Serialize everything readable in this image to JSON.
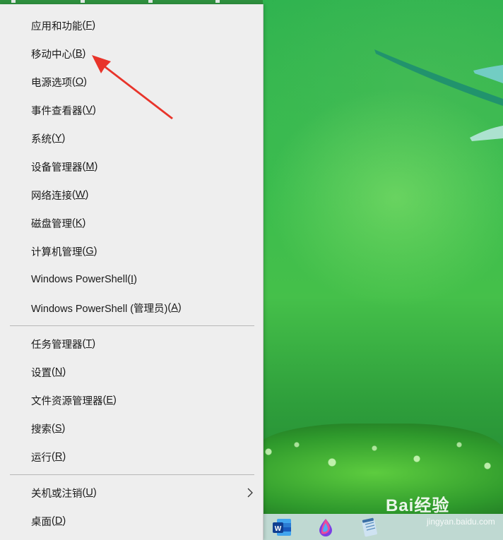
{
  "menu": {
    "group1": [
      {
        "label": "应用和功能",
        "key": "(F)",
        "k": "F"
      },
      {
        "label": "移动中心",
        "key": "(B)",
        "k": "B"
      },
      {
        "label": "电源选项",
        "key": "(O)",
        "k": "O"
      },
      {
        "label": "事件查看器",
        "key": "(V)",
        "k": "V"
      },
      {
        "label": "系统",
        "key": "(Y)",
        "k": "Y"
      },
      {
        "label": "设备管理器",
        "key": "(M)",
        "k": "M"
      },
      {
        "label": "网络连接",
        "key": "(W)",
        "k": "W"
      },
      {
        "label": "磁盘管理",
        "key": "(K)",
        "k": "K"
      },
      {
        "label": "计算机管理",
        "key": "(G)",
        "k": "G"
      },
      {
        "label": "Windows PowerShell",
        "key": "(I)",
        "k": "I"
      },
      {
        "label": "Windows PowerShell (管理员)",
        "key": "(A)",
        "k": "A"
      }
    ],
    "group2": [
      {
        "label": "任务管理器",
        "key": "(T)",
        "k": "T"
      },
      {
        "label": "设置",
        "key": "(N)",
        "k": "N"
      },
      {
        "label": "文件资源管理器",
        "key": "(E)",
        "k": "E"
      },
      {
        "label": "搜索",
        "key": "(S)",
        "k": "S"
      },
      {
        "label": "运行",
        "key": "(R)",
        "k": "R"
      }
    ],
    "group3": [
      {
        "label": "关机或注销",
        "key": "(U)",
        "k": "U",
        "submenu": true
      },
      {
        "label": "桌面",
        "key": "(D)",
        "k": "D"
      }
    ]
  },
  "annotation": {
    "color": "#e8342a",
    "target": "移动中心"
  },
  "taskbar": {
    "icons": [
      "word-icon",
      "paint-drop-icon",
      "notepad-icon"
    ]
  },
  "watermark": {
    "brand": "Bai经验",
    "url": "jingyan.baidu.com"
  },
  "colors": {
    "menu_bg": "#eeeeee",
    "desktop": "#3bbc4e",
    "arrow": "#e8342a"
  }
}
